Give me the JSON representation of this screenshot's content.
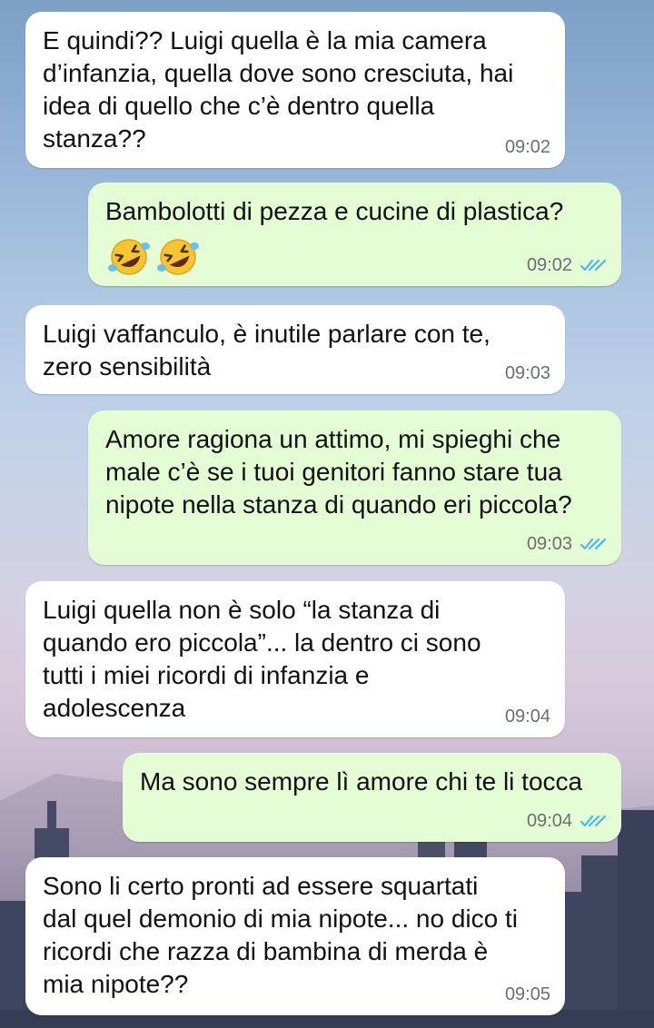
{
  "messages": [
    {
      "dir": "in",
      "text": "E quindi?? Luigi quella è la mia camera\nd’infanzia, quella dove sono cresciuta, hai\nidea di quello che c’è dentro quella\nstanza??",
      "time": "09:02"
    },
    {
      "dir": "out",
      "text": "Bambolotti di pezza e cucine di plastica?",
      "emojis": [
        "rolling-on-floor-laughing",
        "rolling-on-floor-laughing"
      ],
      "time": "09:02",
      "status": "read"
    },
    {
      "dir": "in",
      "text": "Luigi vaffanculo, è inutile parlare con te,\nzero sensibilità",
      "time": "09:03"
    },
    {
      "dir": "out",
      "text": "Amore ragiona un attimo, mi spieghi che\nmale c’è se i tuoi genitori fanno stare tua\nnipote nella stanza di quando eri piccola?",
      "time": "09:03",
      "status": "read"
    },
    {
      "dir": "in",
      "text": "Luigi quella non è solo “la stanza di\nquando ero piccola”... la dentro ci sono\ntutti i miei ricordi di infanzia e\nadolescenza",
      "time": "09:04"
    },
    {
      "dir": "out",
      "text": "Ma sono sempre lì amore chi te li tocca",
      "time": "09:04",
      "status": "read"
    },
    {
      "dir": "in",
      "text": "Sono li certo pronti ad essere squartati\ndal quel demonio di mia nipote... no dico ti\nricordi che razza di bambina di merda è\nmia nipote??",
      "time": "09:05"
    }
  ],
  "colors": {
    "incoming_bubble": "#ffffff",
    "outgoing_bubble": "#e4fdd4",
    "read_ticks": "#4fb6ec",
    "timestamp": "#6a6f72"
  }
}
